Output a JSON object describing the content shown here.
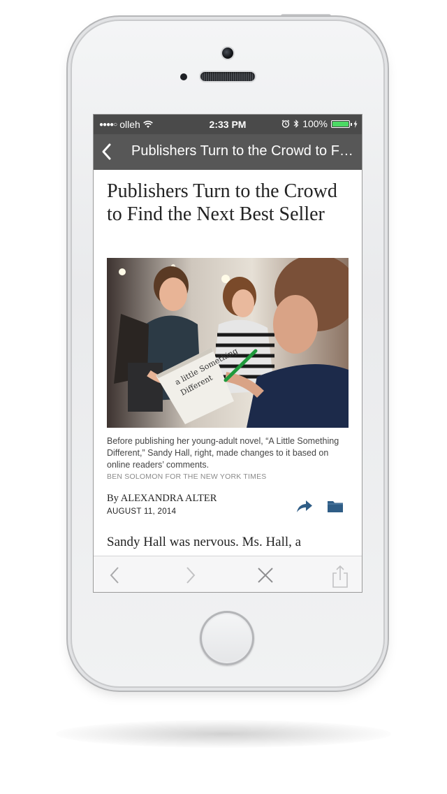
{
  "status_bar": {
    "signal_dots": "●●●●○",
    "carrier": "olleh",
    "time": "2:33 PM",
    "battery_percent": "100%",
    "battery_level": 1.0,
    "icons": [
      "wifi-icon",
      "alarm-icon",
      "bluetooth-icon",
      "battery-icon",
      "charging-icon"
    ]
  },
  "nav": {
    "title": "Publishers Turn to the Crowd to Find the Next Best Seller",
    "back_icon": "chevron-left-icon"
  },
  "article": {
    "headline": "Publishers Turn to the Crowd to Find the Next Best Seller",
    "caption": "Before publishing her young-adult novel, “A Little Something Different,” Sandy Hall, right, made changes to it based on online readers’ comments.",
    "credit": "BEN SOLOMON FOR THE NEW YORK TIMES",
    "byline_prefix": "By ",
    "author": "ALEXANDRA ALTER",
    "date": "AUGUST 11, 2014",
    "body_start": "Sandy Hall was nervous. Ms. Hall, a",
    "book_cover_text": "a little Something Different",
    "actions": [
      "share-icon",
      "folder-icon"
    ]
  },
  "toolbar": {
    "items": [
      "back-arrow-icon",
      "forward-arrow-icon",
      "close-icon",
      "share-out-icon"
    ]
  },
  "colors": {
    "status_bar_bg": "#4a4a4a",
    "nav_bar_bg": "#575757",
    "accent_blue": "#2f5d86",
    "battery_green": "#4cd964",
    "toolbar_bg": "#f6f6f7"
  }
}
